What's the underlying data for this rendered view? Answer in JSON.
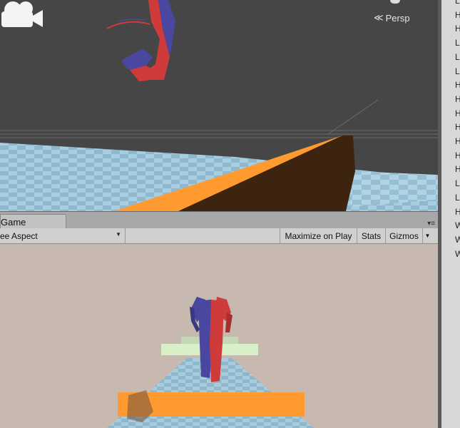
{
  "scene_view": {
    "projection_label": "Persp"
  },
  "game_tab": {
    "label": "Game"
  },
  "game_toolbar": {
    "aspect_label": "ee Aspect",
    "maximize_label": "Maximize on Play",
    "stats_label": "Stats",
    "gizmos_label": "Gizmos"
  },
  "hierarchy": {
    "items": [
      "L",
      "H",
      "H",
      "L",
      "L",
      "L",
      "H",
      "H",
      "H",
      "H",
      "H",
      "H",
      "H",
      "L",
      "L",
      "H",
      "W",
      "W",
      "W"
    ]
  },
  "colors": {
    "scene_bg": "#464646",
    "floor": "#a9cbde",
    "ramp_top": "#ff9a30",
    "ramp_side": "#3c2410",
    "player_red": "#cf3b3b",
    "player_blue": "#4a47a0",
    "game_bg": "#c7b9b0",
    "platform_green": "#d8f0c8"
  },
  "icons": [
    "camera-icon",
    "persp-arrow-icon",
    "dropdown-arrow-icon",
    "tab-menu-icon"
  ]
}
